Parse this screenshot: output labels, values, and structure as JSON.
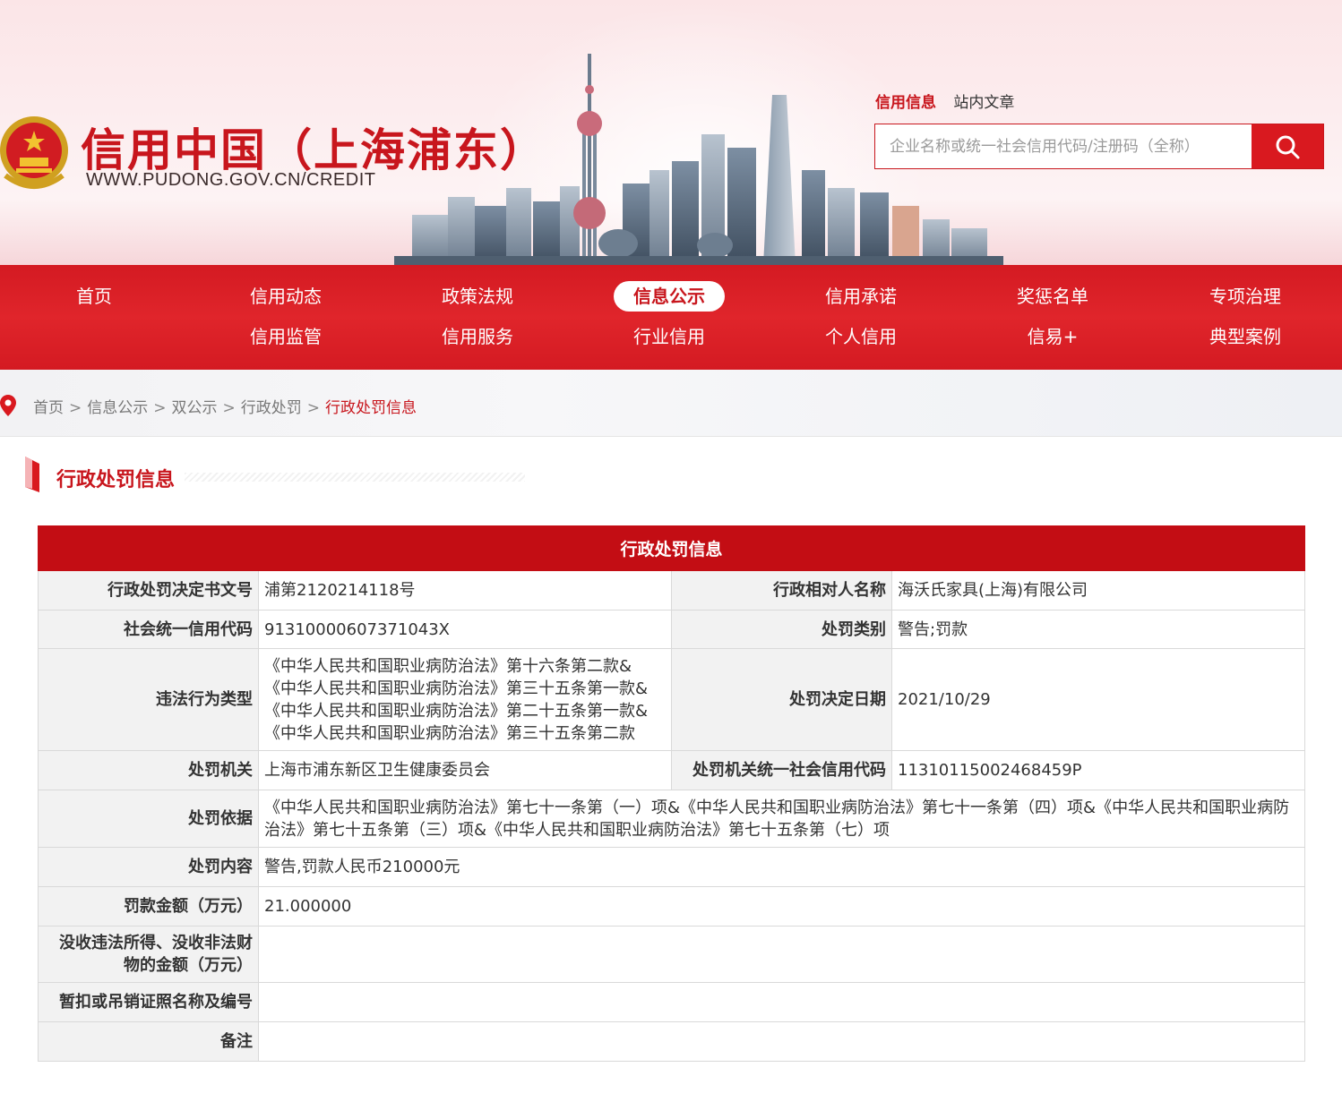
{
  "header": {
    "site_title": "信用中国（上海浦东）",
    "site_url": "WWW.PUDONG.GOV.CN/CREDIT",
    "search_tabs": [
      "信用信息",
      "站内文章"
    ],
    "search_placeholder": "企业名称或统一社会信用代码/注册码（全称）"
  },
  "nav": {
    "row1": [
      "首页",
      "信用动态",
      "政策法规",
      "信息公示",
      "信用承诺",
      "奖惩名单",
      "专项治理"
    ],
    "row2": [
      "信用监管",
      "信用服务",
      "行业信用",
      "个人信用",
      "信易+",
      "典型案例"
    ],
    "active": "信息公示"
  },
  "breadcrumb": [
    "首页",
    "信息公示",
    "双公示",
    "行政处罚",
    "行政处罚信息"
  ],
  "section_title": "行政处罚信息",
  "table": {
    "caption": "行政处罚信息",
    "rows": {
      "decision_no_label": "行政处罚决定书文号",
      "decision_no": "浦第2120214118号",
      "party_label": "行政相对人名称",
      "party": "海沃氏家具(上海)有限公司",
      "credit_code_label": "社会统一信用代码",
      "credit_code": "91310000607371043X",
      "penalty_type_label": "处罚类别",
      "penalty_type": "警告;罚款",
      "violation_label": "违法行为类型",
      "violation_lines": [
        "《中华人民共和国职业病防治法》第十六条第二款&",
        "《中华人民共和国职业病防治法》第三十五条第一款&",
        "《中华人民共和国职业病防治法》第二十五条第一款&",
        "《中华人民共和国职业病防治法》第三十五条第二款"
      ],
      "decision_date_label": "处罚决定日期",
      "decision_date": "2021/10/29",
      "authority_label": "处罚机关",
      "authority": "上海市浦东新区卫生健康委员会",
      "authority_code_label": "处罚机关统一社会信用代码",
      "authority_code": "11310115002468459P",
      "basis_label": "处罚依据",
      "basis": "《中华人民共和国职业病防治法》第七十一条第（一）项&《中华人民共和国职业病防治法》第七十一条第（四）项&《中华人民共和国职业病防治法》第七十五条第（三）项&《中华人民共和国职业病防治法》第七十五条第（七）项",
      "content_label": "处罚内容",
      "content": "警告,罚款人民币210000元",
      "fine_label": "罚款金额（万元）",
      "fine": "21.000000",
      "confiscation_label": "没收违法所得、没收非法财物的金额（万元）",
      "confiscation": "",
      "license_label": "暂扣或吊销证照名称及编号",
      "license": "",
      "remark_label": "备注",
      "remark": ""
    }
  },
  "colors": {
    "brand_red": "#c8161d",
    "nav_red": "#d9191f",
    "header_pink": "#fbe5e7"
  }
}
